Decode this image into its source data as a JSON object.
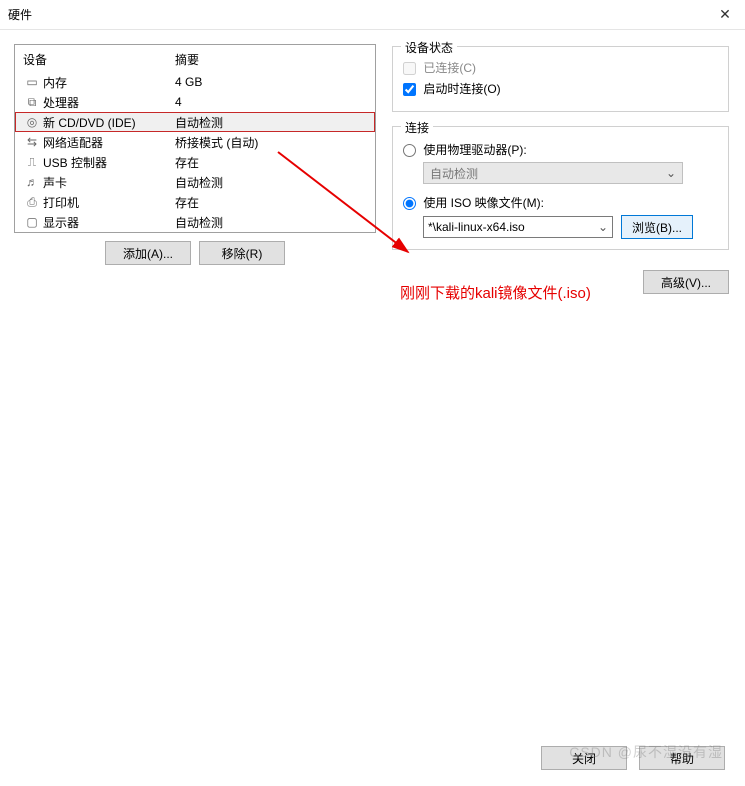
{
  "title": "硬件",
  "left": {
    "col_device": "设备",
    "col_summary": "摘要",
    "rows": [
      {
        "icon": "memory-icon",
        "name": "内存",
        "summary": "4 GB"
      },
      {
        "icon": "cpu-icon",
        "name": "处理器",
        "summary": "4"
      },
      {
        "icon": "disc-icon",
        "name": "新 CD/DVD (IDE)",
        "summary": "自动检测",
        "selected": true
      },
      {
        "icon": "network-icon",
        "name": "网络适配器",
        "summary": "桥接模式 (自动)"
      },
      {
        "icon": "usb-icon",
        "name": "USB 控制器",
        "summary": "存在"
      },
      {
        "icon": "sound-icon",
        "name": "声卡",
        "summary": "自动检测"
      },
      {
        "icon": "printer-icon",
        "name": "打印机",
        "summary": "存在"
      },
      {
        "icon": "display-icon",
        "name": "显示器",
        "summary": "自动检测"
      }
    ],
    "add_btn": "添加(A)...",
    "remove_btn": "移除(R)"
  },
  "status_group": {
    "title": "设备状态",
    "connected": "已连接(C)",
    "connect_on_start": "启动时连接(O)"
  },
  "conn_group": {
    "title": "连接",
    "use_physical": "使用物理驱动器(P):",
    "physical_value": "自动检测",
    "use_iso": "使用 ISO 映像文件(M):",
    "iso_value": "*\\kali-linux-x64.iso",
    "browse": "浏览(B)..."
  },
  "advanced_btn": "高级(V)...",
  "footer": {
    "close": "关闭",
    "help": "帮助"
  },
  "annotation": "刚刚下载的kali镜像文件(.iso)",
  "watermark": "CSDN @尿不湿没有湿"
}
